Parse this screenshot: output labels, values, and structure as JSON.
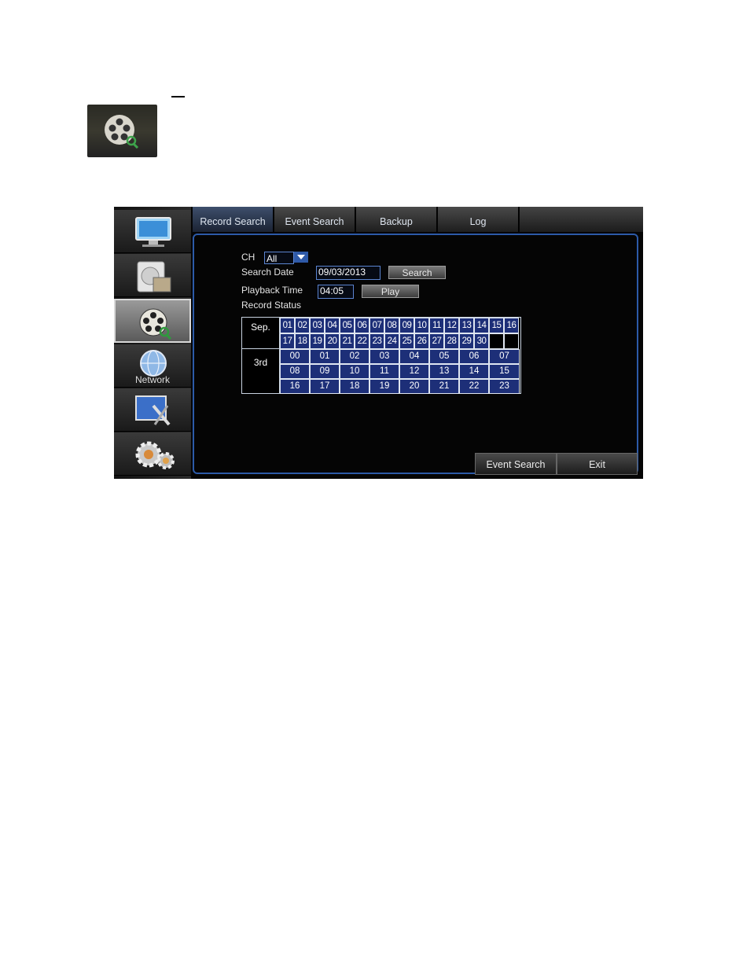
{
  "tabs": [
    "Record Search",
    "Event Search",
    "Backup",
    "Log"
  ],
  "sidebar": {
    "network_label": "Network"
  },
  "form": {
    "ch_label": "CH",
    "ch_value": "All",
    "search_date_label": "Search Date",
    "search_date_value": "09/03/2013",
    "search_button": "Search",
    "playback_time_label": "Playback Time",
    "playback_time_value": "04:05",
    "play_button": "Play",
    "record_status_label": "Record Status"
  },
  "calendar": {
    "month": "Sep.",
    "days_row1": [
      "01",
      "02",
      "03",
      "04",
      "05",
      "06",
      "07",
      "08",
      "09",
      "10",
      "11",
      "12",
      "13",
      "14",
      "15",
      "16"
    ],
    "days_row2": [
      "17",
      "18",
      "19",
      "20",
      "21",
      "22",
      "23",
      "24",
      "25",
      "26",
      "27",
      "28",
      "29",
      "30",
      "",
      ""
    ],
    "day_label": "3rd",
    "hours": [
      [
        "00",
        "01",
        "02",
        "03",
        "04",
        "05",
        "06",
        "07"
      ],
      [
        "08",
        "09",
        "10",
        "11",
        "12",
        "13",
        "14",
        "15"
      ],
      [
        "16",
        "17",
        "18",
        "19",
        "20",
        "21",
        "22",
        "23"
      ]
    ]
  },
  "footer": {
    "event_search": "Event Search",
    "exit": "Exit"
  }
}
